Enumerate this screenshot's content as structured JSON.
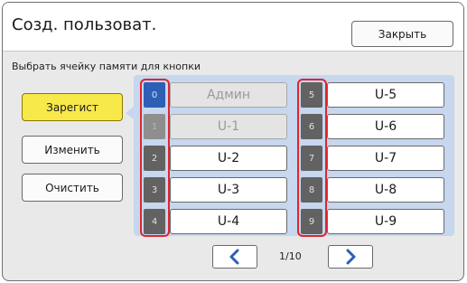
{
  "header": {
    "title": "Созд. пользоват.",
    "close_label": "Закрыть"
  },
  "subtitle": "Выбрать ячейку памяти для кнопки",
  "actions": [
    {
      "label": "Зарегист",
      "active": true
    },
    {
      "label": "Изменить",
      "active": false
    },
    {
      "label": "Очистить",
      "active": false
    }
  ],
  "slots_left": [
    {
      "number": "0",
      "name": "Админ",
      "state": "selected-disabled"
    },
    {
      "number": "1",
      "name": "U-1",
      "state": "disabled"
    },
    {
      "number": "2",
      "name": "U-2",
      "state": "normal"
    },
    {
      "number": "3",
      "name": "U-3",
      "state": "normal"
    },
    {
      "number": "4",
      "name": "U-4",
      "state": "normal"
    }
  ],
  "slots_right": [
    {
      "number": "5",
      "name": "U-5",
      "state": "normal"
    },
    {
      "number": "6",
      "name": "U-6",
      "state": "normal"
    },
    {
      "number": "7",
      "name": "U-7",
      "state": "normal"
    },
    {
      "number": "8",
      "name": "U-8",
      "state": "normal"
    },
    {
      "number": "9",
      "name": "U-9",
      "state": "normal"
    }
  ],
  "pagination": {
    "text": "1/10",
    "prev_icon": "chevron-left-icon",
    "next_icon": "chevron-right-icon"
  },
  "colors": {
    "accent_blue": "#2d5fb5",
    "active_yellow": "#f7e94a",
    "highlight_red": "#e3242b",
    "panel_bg": "#c6d7ee"
  }
}
